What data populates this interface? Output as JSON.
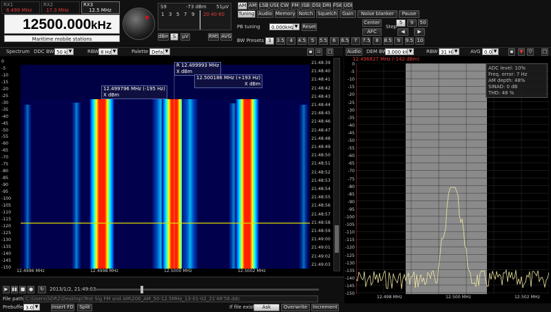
{
  "vfo": {
    "slots": [
      {
        "name": "RX1",
        "freq": "6.499 MHz"
      },
      {
        "name": "RX2",
        "freq": "17.3 MHz"
      },
      {
        "name": "RX3",
        "freq": "12.5 MHz"
      }
    ],
    "frequency": "12500.000",
    "unit": "kHz",
    "station": "Maritime mobile stations"
  },
  "smeter": {
    "s_label": "S9",
    "dbm": "-73 dBm",
    "uv": "51µV",
    "scale": [
      "1",
      "3",
      "5",
      "7",
      "9",
      "20",
      "40",
      "60"
    ],
    "units": {
      "dbm": "dBm",
      "s": "S",
      "uv": "µV",
      "rms": "RMS",
      "avg": "AVG"
    }
  },
  "modes": [
    "AM",
    "AMS",
    "LSB",
    "USB",
    "CW",
    "FM",
    "ISB",
    "DSB",
    "DRM",
    "FSK",
    "UDM"
  ],
  "mode_active": "AM",
  "tabs": [
    "Tuning",
    "Audio",
    "Memory",
    "Notch",
    "Squelch",
    "Gain",
    "Noise blanker",
    "Pause"
  ],
  "tab_active": "Tuning",
  "tuning": {
    "pb_label": "PB tuning",
    "pb_value": "0.000kHz",
    "reset": "Reset",
    "center": "Center",
    "afc": "AFC",
    "step_label": "Step",
    "steps_top": [
      "5",
      "9",
      "50"
    ],
    "bw_label": "BW Presets",
    "presets": [
      "3",
      "3.5",
      "4",
      "4.5",
      "5",
      "5.5",
      "6",
      "6.5",
      "7",
      "7.5",
      "8",
      "8.5",
      "9",
      "9.5",
      "10"
    ]
  },
  "spectrum_toolbar": {
    "spectrum": "Spectrum",
    "ddc_label": "DDC BW",
    "ddc_value": "50 kHz",
    "rbw_label": "RBW",
    "rbw_value": "8 Hz",
    "palette_label": "Palette",
    "palette_value": "Default"
  },
  "audio_toolbar": {
    "audio": "Audio",
    "dem_label": "DEM BW",
    "dem_value": "3.000 kHz",
    "rbw_label": "RBW",
    "rbw_value": "31 Hz",
    "avg_label": "AVG",
    "avg_value": "0.0s"
  },
  "waterfall": {
    "db_ticks": [
      "0",
      "-5",
      "-10",
      "-15",
      "-20",
      "-25",
      "-30",
      "-35",
      "-40",
      "-45",
      "-50",
      "-55",
      "-60",
      "-65",
      "-70",
      "-75",
      "-80",
      "-85",
      "-90",
      "-95",
      "-100",
      "-105",
      "-110",
      "-115",
      "-120",
      "-125",
      "-130",
      "-135",
      "-140",
      "-145",
      "-150"
    ],
    "times": [
      "21:48:39",
      "21:48:40",
      "21:48:41",
      "21:48:42",
      "21:48:43",
      "21:48:44",
      "21:48:45",
      "21:48:46",
      "21:48:47",
      "21:48:48",
      "21:48:49",
      "21:48:50",
      "21:48:51",
      "21:48:52",
      "21:48:53",
      "21:48:54",
      "21:48:55",
      "21:48:56",
      "21:48:57",
      "21:48:58",
      "21:48:59",
      "21:49:00",
      "21:49:01",
      "21:49:02",
      "21:49:03"
    ],
    "freq_ticks": [
      "12.4996 MHz",
      "12.4998 MHz",
      "12.5000 MHz",
      "12.5002 MHz"
    ],
    "markers": [
      {
        "line1": "12.499796 MHz (-195 Hz)",
        "line2": "X dBm"
      },
      {
        "line1": "R 12.499993 MHz",
        "line2": "X dBm"
      },
      {
        "line1": "12.500186 MHz (+193 Hz)",
        "line2": "X dBm"
      }
    ]
  },
  "audio_panel": {
    "cursor_readout": "12.496827 MHz (-142 dBm)",
    "stats": [
      "ADC level: 10%",
      "Freq. error: 7 Hz",
      "AM depth: 48%",
      "SINAD: 0 dB",
      "THD: 48 %"
    ],
    "db_ticks": [
      "0",
      "-5",
      "-10",
      "-15",
      "-20",
      "-25",
      "-30",
      "-35",
      "-40",
      "-45",
      "-50",
      "-55",
      "-60",
      "-65",
      "-70",
      "-75",
      "-80",
      "-85",
      "-90",
      "-95",
      "-100",
      "-105",
      "-110",
      "-115",
      "-120",
      "-125",
      "-130",
      "-135",
      "-140",
      "-145",
      "-150"
    ],
    "freq_ticks": [
      "12.498 MHz",
      "12.500 MHz",
      "12.502 MHz"
    ]
  },
  "playback": {
    "timestamp": "2013/1/2, 21:49:03",
    "file_label": "File path",
    "file_path": "C:\\Users\\SDR2\\Desktop\\Test Sig FM and AM\\200_AM_50-12.5MHz_13-01-02_21'48'58.ddc",
    "prebuffer_label": "Prebuffer",
    "prebuffer_value": "3.0s",
    "insert_fdt": "Insert FDT",
    "split": "Split",
    "if_exists": "If file exists",
    "ask": "Ask",
    "overwrite": "Overwrite",
    "increment": "Increment"
  },
  "colors": {
    "accent_red": "#e43b3b",
    "waterfall_bg": "#000044",
    "audio_trace": "#f0e8a0",
    "passband": "#b8b8b8"
  }
}
